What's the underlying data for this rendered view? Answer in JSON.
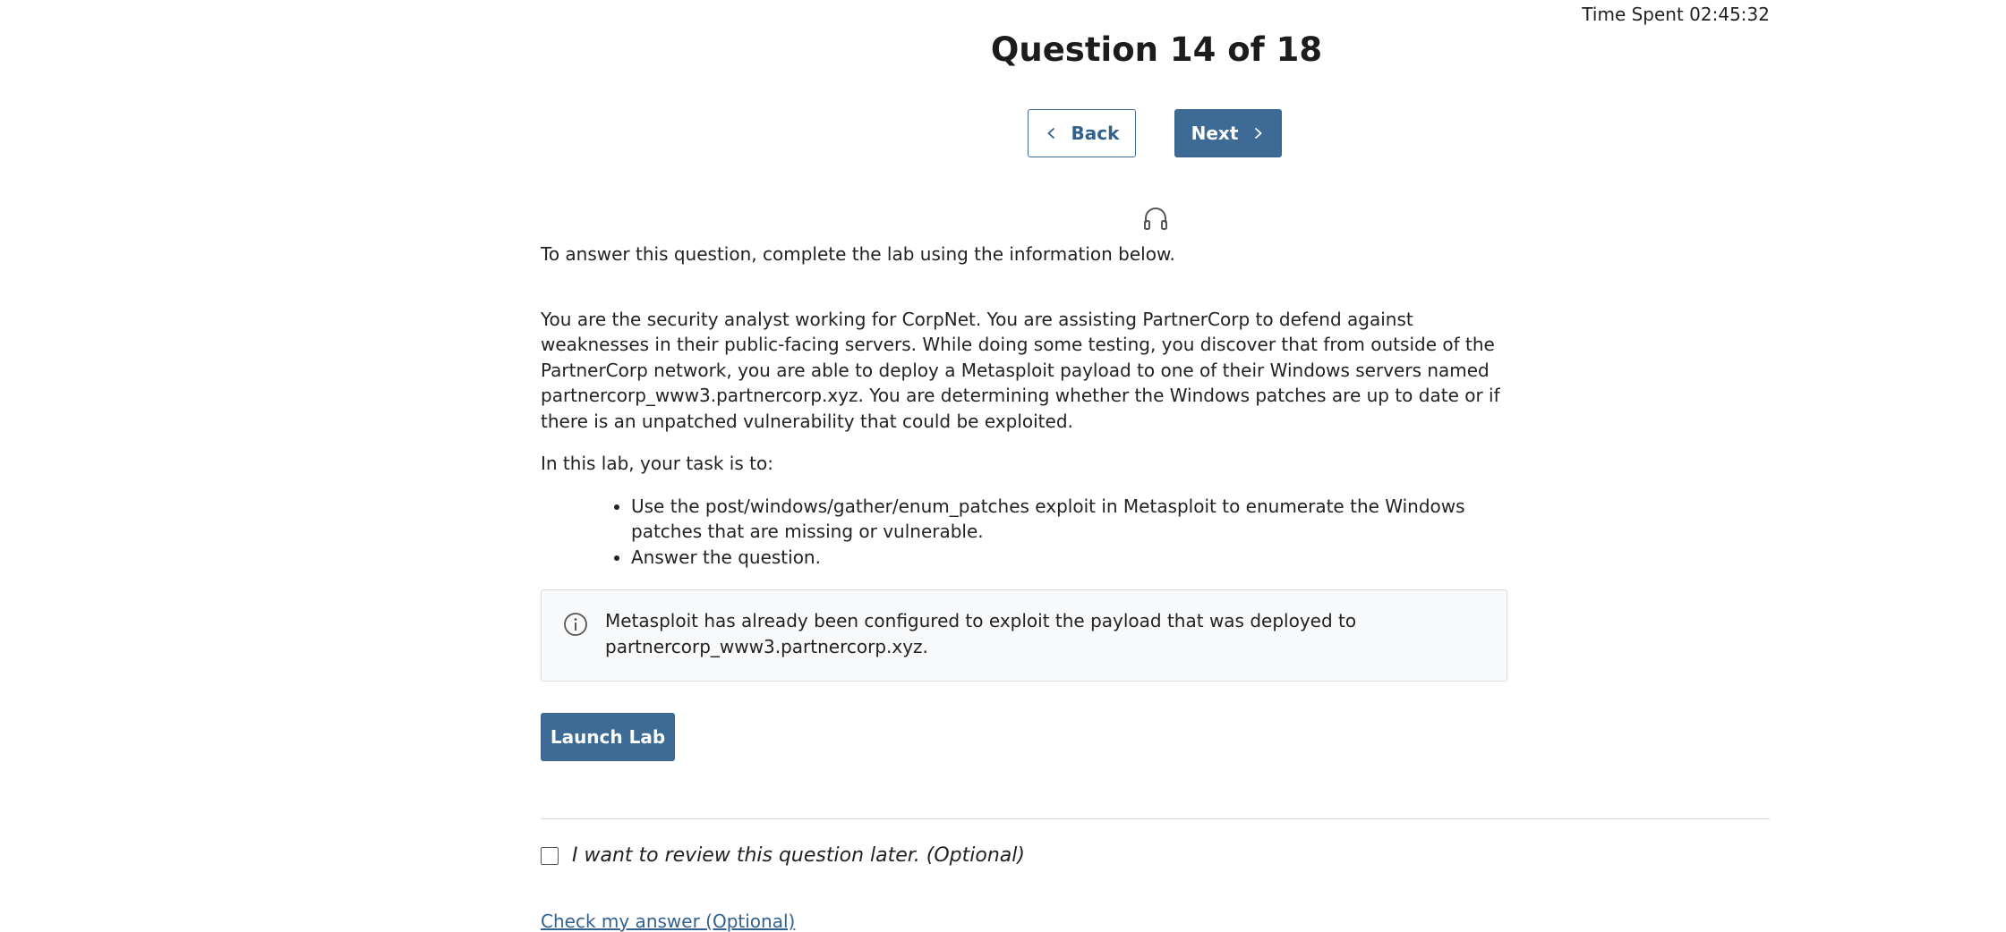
{
  "header": {
    "time_spent": "Time Spent 02:45:32",
    "title": "Question 14 of 18"
  },
  "nav": {
    "back_label": "Back",
    "next_label": "Next"
  },
  "icons": {
    "audio": "headphones-icon",
    "info": "info-icon",
    "back": "chevron-left-icon",
    "next": "chevron-right-icon"
  },
  "question": {
    "intro": "To answer this question, complete the lab using the information below.",
    "scenario": "You are the security analyst working for CorpNet. You are assisting PartnerCorp to defend against weaknesses in their public-facing servers. While doing some testing, you discover that from outside of the PartnerCorp network, you are able to deploy a Metasploit payload to one of their Windows servers named partnercorp_www3.partnercorp.xyz. You are determining whether the Windows patches are up to date or if there is an unpatched vulnerability that could be exploited.",
    "task_intro": "In this lab, your task is to:",
    "tasks": [
      "Use the post/windows/gather/enum_patches exploit in Metasploit to enumerate the Windows patches that are missing or vulnerable.",
      "Answer the question."
    ],
    "note": "Metasploit has already been configured to exploit the payload that was deployed to partnercorp_www3.partnercorp.xyz."
  },
  "actions": {
    "launch_label": "Launch Lab",
    "review_label": "I want to review this question later. (Optional)",
    "review_checked": false,
    "check_answer_label": "Check my answer (Optional)"
  },
  "colors": {
    "primary": "#3e6a96",
    "link": "#33618f",
    "note_bg": "#f8f9fa",
    "note_border": "#d6d9dd"
  }
}
